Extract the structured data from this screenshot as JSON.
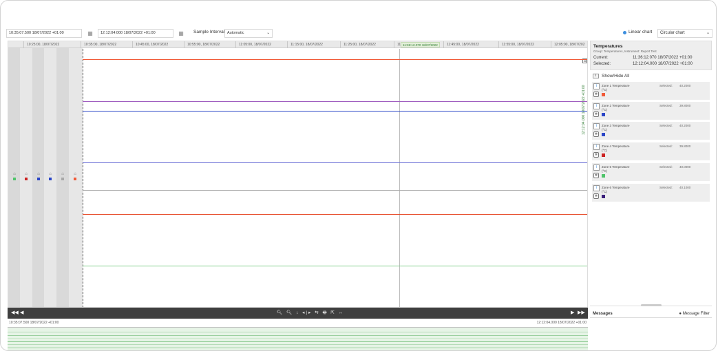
{
  "toolbar": {
    "start_time": "10:35:07.500 18/07/2022 +01:00",
    "end_time": "12:12:04:000 18/07/2022 +01:00",
    "calendar_icon": "calendar-icon",
    "sample_interval_label": "Sample Interval",
    "sample_interval_value": "Automatic",
    "linear_chart_label": "Linear chart",
    "chart_type_value": "Circular chart"
  },
  "chart": {
    "time_ticks": [
      "10:25:00, 18/07/2022",
      "10:35:00, 18/07/2022",
      "10:45:00, 18/07/2022",
      "10:55:00, 18/07/2022",
      "11:05:00, 18/07/2022",
      "11:15:00, 18/07/2022",
      "11:25:00, 18/07/2022",
      "11",
      "11:45:00, 18/07/2022",
      "11:55:00, 18/07/2022",
      "12:05:00, 18/07/202"
    ],
    "cursor_label": "11:36:12.070 18/07/2022",
    "vertical_cursor_text": "12:12:04.000 18/07/2022 +01:00",
    "series_colors": [
      "#f15a38",
      "#a05ec0",
      "#2b46c7",
      "#7074d8",
      "#a8a8a8",
      "#e64a27",
      "#7fcf8a"
    ]
  },
  "nav": {
    "first_label": "◀◀",
    "prev_label": "◀",
    "next_label": "▶",
    "last_label": "▶▶",
    "tools_text": "🔍︎ 🔍︎ ↕ ◂|▸ ⇆ 🖶 ⇱ ↔"
  },
  "range": {
    "start": "10:35:07.500 18/07/2022 +01:00",
    "end": "12:12:04.000 18/07/2022 +01:00"
  },
  "panel": {
    "title": "Temperatures",
    "subtitle": "Group: Temperatures, Instrument: Report Test",
    "current_label": "Current:",
    "current_value": "11:36:12.070 18/07/2022 +01:00",
    "selected_label": "Selected:",
    "selected_value": "12:12:04.000 18/07/2022 +01:00",
    "show_hide_label": "Show/Hide All",
    "zones": [
      {
        "name": "Zone 1 Temperature",
        "unit": "(°C)",
        "selected_label": "Selected:",
        "value": "40.2000",
        "color": "#f15a38"
      },
      {
        "name": "Zone 2 Temperature",
        "unit": "(°C)",
        "selected_label": "Selected:",
        "value": "39.8000",
        "color": "#2b46c7"
      },
      {
        "name": "Zone 3 Temperature",
        "unit": "(°C)",
        "selected_label": "Selected:",
        "value": "40.2000",
        "color": "#2b46c7"
      },
      {
        "name": "Zone 4 Temperature",
        "unit": "(°C)",
        "selected_label": "Selected:",
        "value": "39.8000",
        "color": "#cc2222"
      },
      {
        "name": "Zone 5 Temperature",
        "unit": "(°C)",
        "selected_label": "Selected:",
        "value": "40.0000",
        "color": "#4ec46a"
      },
      {
        "name": "Zone 6 Temperature",
        "unit": "(°C)",
        "selected_label": "Selected:",
        "value": "40.1000",
        "color": "#3a1f7a"
      }
    ],
    "messages_label": "Messages",
    "message_filter_label": "Message Filter"
  }
}
